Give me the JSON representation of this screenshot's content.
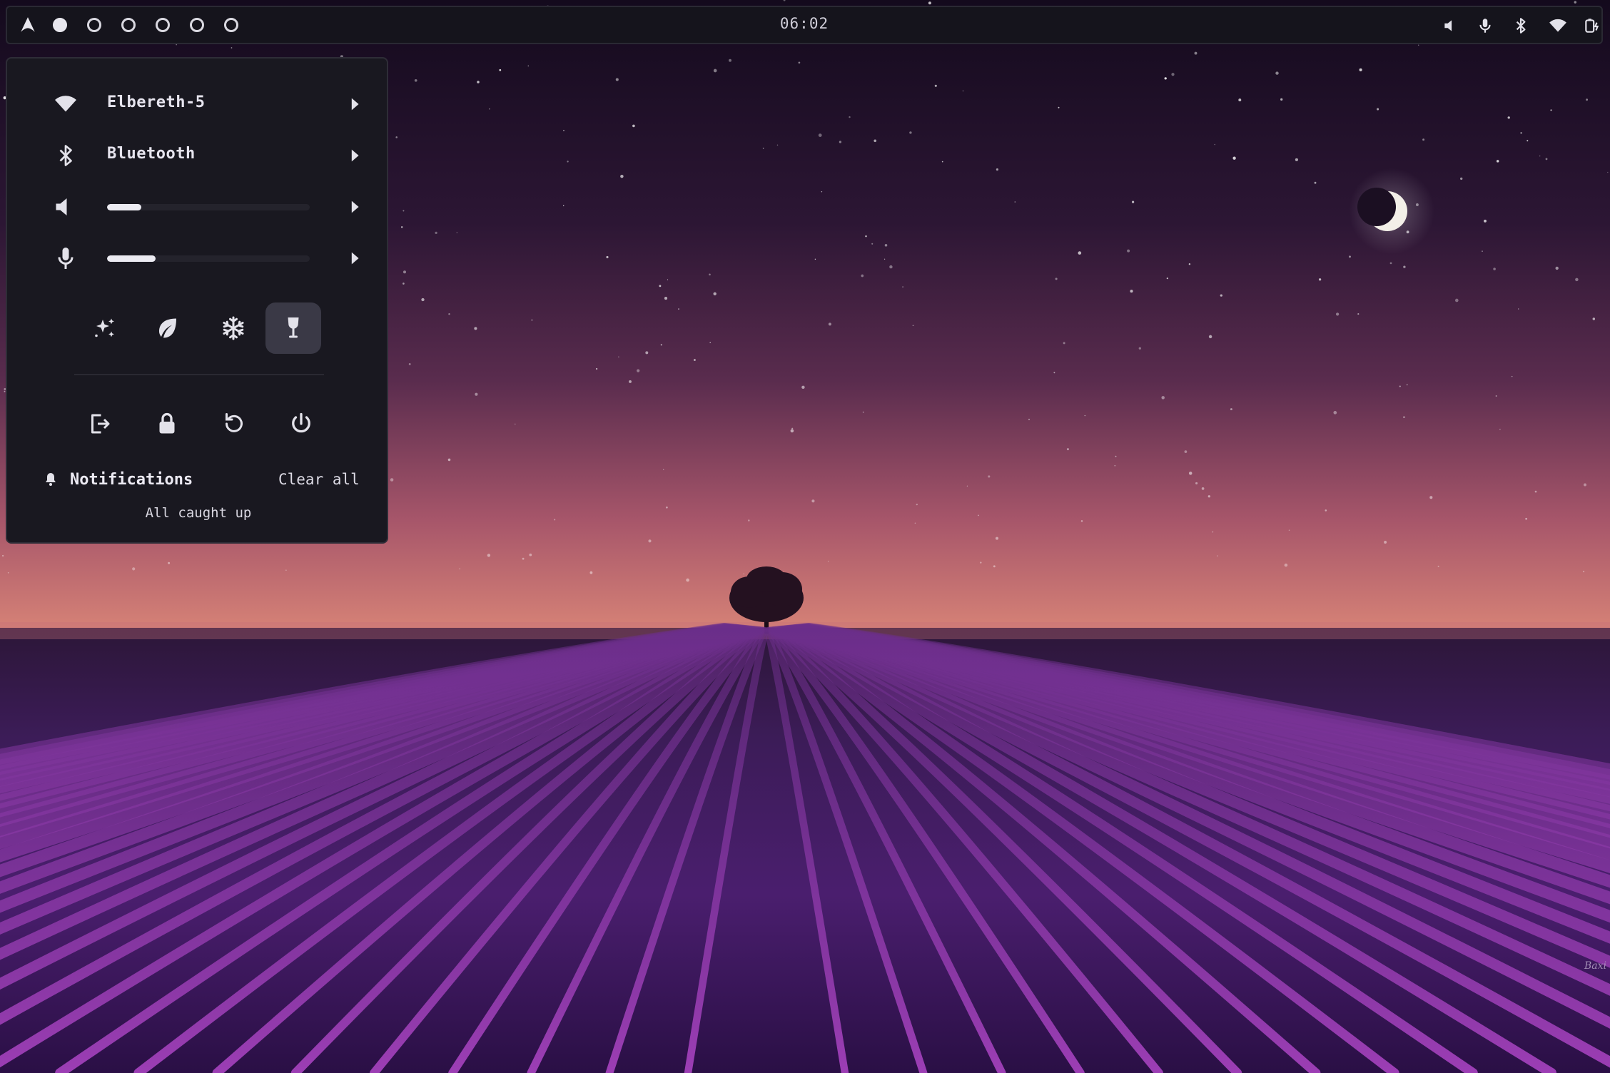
{
  "topbar": {
    "logo_icon": "arch-logo-icon",
    "workspaces": [
      {
        "index": 1,
        "active": true
      },
      {
        "index": 2,
        "active": false
      },
      {
        "index": 3,
        "active": false
      },
      {
        "index": 4,
        "active": false
      },
      {
        "index": 5,
        "active": false
      },
      {
        "index": 6,
        "active": false
      }
    ],
    "clock": "06:02",
    "tray_icons": [
      "volume-icon",
      "microphone-icon",
      "bluetooth-icon",
      "wifi-icon",
      "battery-charging-icon"
    ]
  },
  "quick_settings": {
    "wifi": {
      "label": "Elbereth-5",
      "icon": "wifi-icon"
    },
    "bluetooth": {
      "label": "Bluetooth",
      "icon": "bluetooth-icon"
    },
    "volume": {
      "icon": "volume-icon",
      "level": 0.17
    },
    "microphone": {
      "icon": "microphone-icon",
      "level": 0.24
    },
    "toggles": [
      {
        "name": "effects",
        "icon": "sparkles-icon",
        "active": false
      },
      {
        "name": "power-saver",
        "icon": "leaf-icon",
        "active": false
      },
      {
        "name": "cooling",
        "icon": "snowflake-icon",
        "active": false
      },
      {
        "name": "caffeine",
        "icon": "wine-glass-icon",
        "active": true
      }
    ],
    "power_buttons": [
      "logout-icon",
      "lock-icon",
      "restart-icon",
      "power-icon"
    ]
  },
  "notifications": {
    "title": "Notifications",
    "clear_label": "Clear all",
    "empty_text": "All caught up"
  },
  "colors": {
    "panel_bg": "#191820",
    "bar_bg": "#15141c",
    "accent": "#ecebf2",
    "active_tile": "#3a3946"
  },
  "wallpaper": {
    "watermark": "Baxi"
  }
}
